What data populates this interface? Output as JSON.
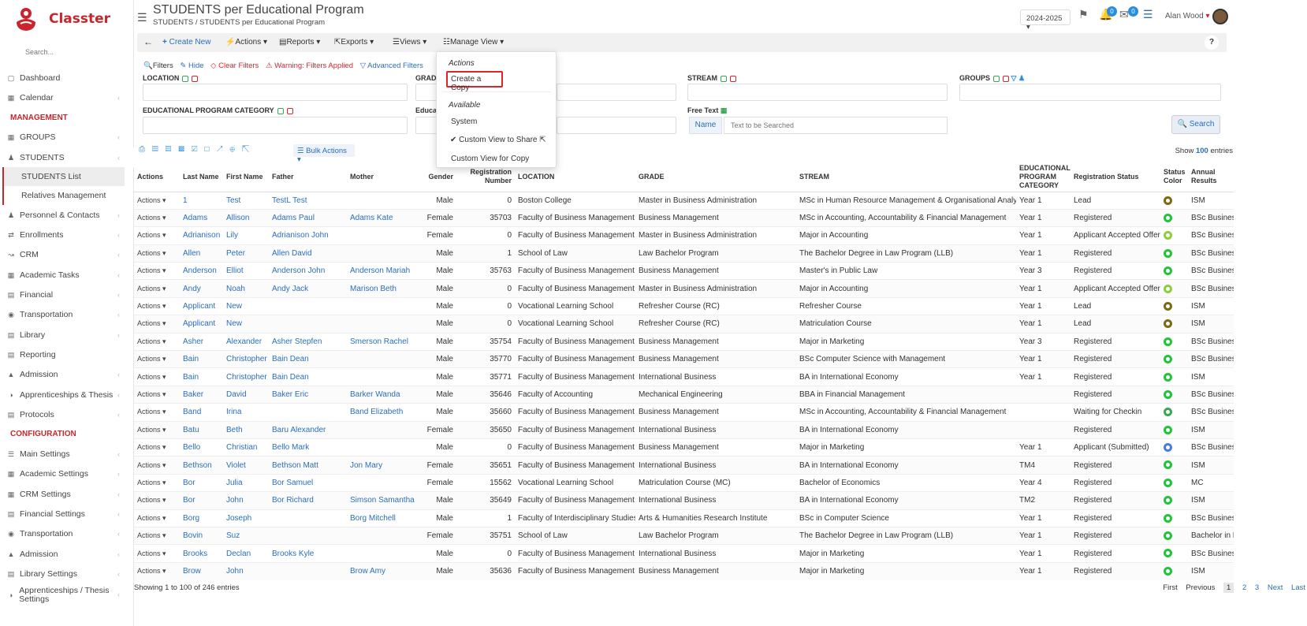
{
  "sidebar": {
    "brand": "Classter",
    "search_placeholder": "Search...",
    "items": [
      {
        "label": "Dashboard",
        "type": "item"
      },
      {
        "label": "Calendar",
        "type": "item",
        "chev": true
      },
      {
        "label": "MANAGEMENT",
        "type": "section"
      },
      {
        "label": "GROUPS",
        "type": "item",
        "chev": true
      },
      {
        "label": "STUDENTS",
        "type": "item",
        "chev": true,
        "active": true
      },
      {
        "label": "STUDENTS List",
        "type": "sub",
        "selected": true
      },
      {
        "label": "Relatives Management",
        "type": "sub"
      },
      {
        "label": "Personnel & Contacts",
        "type": "item",
        "chev": true
      },
      {
        "label": "Enrollments",
        "type": "item",
        "chev": true
      },
      {
        "label": "CRM",
        "type": "item",
        "chev": true
      },
      {
        "label": "Academic Tasks",
        "type": "item",
        "chev": true
      },
      {
        "label": "Financial",
        "type": "item",
        "chev": true
      },
      {
        "label": "Transportation",
        "type": "item",
        "chev": true
      },
      {
        "label": "Library",
        "type": "item",
        "chev": true
      },
      {
        "label": "Reporting",
        "type": "item"
      },
      {
        "label": "Admission",
        "type": "item",
        "chev": true
      },
      {
        "label": "Apprenticeships & Thesis",
        "type": "item",
        "chev": true
      },
      {
        "label": "Protocols",
        "type": "item",
        "chev": true
      },
      {
        "label": "CONFIGURATION",
        "type": "section"
      },
      {
        "label": "Main Settings",
        "type": "item",
        "chev": true
      },
      {
        "label": "Academic Settings",
        "type": "item",
        "chev": true
      },
      {
        "label": "CRM Settings",
        "type": "item",
        "chev": true
      },
      {
        "label": "Financial Settings",
        "type": "item",
        "chev": true
      },
      {
        "label": "Transportation",
        "type": "item",
        "chev": true
      },
      {
        "label": "Admission",
        "type": "item",
        "chev": true
      },
      {
        "label": "Library Settings",
        "type": "item",
        "chev": true
      },
      {
        "label": "Apprenticeships / Thesis Settings",
        "type": "item",
        "chev": true
      }
    ]
  },
  "header": {
    "title": "STUDENTS per Educational Program",
    "breadcrumb": "STUDENTS /  STUDENTS per Educational Program",
    "year": "2024-2025",
    "notif_count": "0",
    "msg_count": "0",
    "user": "Alan Wood"
  },
  "toolbar": {
    "create": "Create New",
    "actions": "Actions",
    "reports": "Reports",
    "exports": "Exports",
    "views": "Views",
    "manage": "Manage View",
    "help": "?"
  },
  "filters": {
    "filters": "Filters",
    "hide": "Hide",
    "clear": "Clear Filters",
    "warning": "Warning: Filters Applied",
    "advanced": "Advanced Filters",
    "location": "LOCATION",
    "grade": "GRADE",
    "stream": "STREAM",
    "groups": "GROUPS",
    "epc": "EDUCATIONAL PROGRAM CATEGORY",
    "educat": "Educat",
    "free_text": "Free Text",
    "name_tag": "Name",
    "free_placeholder": "Text to be Searched",
    "search": "Search"
  },
  "table_tools": {
    "bulk": "Bulk Actions",
    "show_prefix": "Show",
    "show_count": "100",
    "show_suffix": "entries"
  },
  "dropdown": {
    "actions_h": "Actions",
    "create_copy": "Create a Copy",
    "available_h": "Available",
    "system": "System",
    "custom_share": "Custom View to Share",
    "custom_copy": "Custom View for Copy"
  },
  "columns": [
    "Actions",
    "Last Name",
    "First Name",
    "Father",
    "Mother",
    "Gender",
    "Registration Number",
    "LOCATION",
    "GRADE",
    "STREAM",
    "EDUCATIONAL PROGRAM CATEGORY",
    "Registration Status",
    "Status Color",
    "Annual Results"
  ],
  "rows": [
    [
      "Actions",
      "1",
      "Test",
      "TestL Test",
      "",
      "Male",
      "0",
      "Boston College",
      "Master in Business Administration",
      "MSc in Human Resource Management & Organisational Analysis",
      "Year 1",
      "Lead",
      "#7a6a10",
      "ISM"
    ],
    [
      "Actions",
      "Adams",
      "Allison",
      "Adams Paul",
      "Adams Kate",
      "Female",
      "35703",
      "Faculty of Business Management",
      "Business Management",
      "MSc in Accounting, Accountability & Financial Management",
      "Year 1",
      "Registered",
      "#22c33a",
      "BSc Business I"
    ],
    [
      "Actions",
      "Adrianison",
      "Lily",
      "Adrianison John",
      "",
      "Female",
      "0",
      "Faculty of Business Management",
      "Master in Business Administration",
      "Major in Accounting",
      "Year 1",
      "Applicant Accepted Offer",
      "#8ccf3c",
      "BSc Business I"
    ],
    [
      "Actions",
      "Allen",
      "Peter",
      "Allen David",
      "",
      "Male",
      "1",
      "School of Law",
      "Law Bachelor Program",
      "The Bachelor Degree in Law Program (LLB)",
      "Year 1",
      "Registered",
      "#22c33a",
      "BSc Business I"
    ],
    [
      "Actions",
      "Anderson",
      "Elliot",
      "Anderson John",
      "Anderson Mariah",
      "Male",
      "35763",
      "Faculty of Business Management",
      "Business Management",
      "Master's in Public Law",
      "Year 3",
      "Registered",
      "#22c33a",
      "BSc Business I"
    ],
    [
      "Actions",
      "Andy",
      "Noah",
      "Andy Jack",
      "Marison Beth",
      "Male",
      "0",
      "Faculty of Business Management",
      "Master in Business Administration",
      "Major in Accounting",
      "Year 1",
      "Applicant Accepted Offer",
      "#8ccf3c",
      "BSc Business I"
    ],
    [
      "Actions",
      "Applicant",
      "New",
      "",
      "",
      "Male",
      "0",
      "Vocational Learning School",
      "Refresher Course (RC)",
      "Refresher Course",
      "Year 1",
      "Lead",
      "#7a6a10",
      "ISM"
    ],
    [
      "Actions",
      "Applicant",
      "New",
      "",
      "",
      "Male",
      "0",
      "Vocational Learning School",
      "Refresher Course (RC)",
      "Matriculation Course",
      "Year 1",
      "Lead",
      "#7a6a10",
      "ISM"
    ],
    [
      "Actions",
      "Asher",
      "Alexander",
      "Asher Stepfen",
      "Smerson Rachel",
      "Male",
      "35754",
      "Faculty of Business Management",
      "Business Management",
      "Major in Marketing",
      "Year 3",
      "Registered",
      "#22c33a",
      "BSc Business I"
    ],
    [
      "Actions",
      "Bain",
      "Christopher",
      "Bain Dean",
      "",
      "Male",
      "35770",
      "Faculty of Business Management",
      "Business Management",
      "BSc Computer Science with Management",
      "Year 1",
      "Registered",
      "#22c33a",
      "BSc Business I"
    ],
    [
      "Actions",
      "Bain",
      "Christopher",
      "Bain Dean",
      "",
      "Male",
      "35771",
      "Faculty of Business Management",
      "International Business",
      "BA in International Economy",
      "Year 1",
      "Registered",
      "#22c33a",
      "ISM"
    ],
    [
      "Actions",
      "Baker",
      "David",
      "Baker Eric",
      "Barker Wanda",
      "Male",
      "35646",
      "Faculty of Accounting",
      "Mechanical Engineering",
      "BBA in Financial Management",
      "",
      "Registered",
      "#22c33a",
      "BSc Business I"
    ],
    [
      "Actions",
      "Band",
      "Irina",
      "",
      "Band Elizabeth",
      "Male",
      "35660",
      "Faculty of Business Management",
      "Business Management",
      "MSc in Accounting, Accountability & Financial Management",
      "",
      "Waiting for Checkin",
      "#3aa655",
      "BSc Business I"
    ],
    [
      "Actions",
      "Batu",
      "Beth",
      "Baru Alexander",
      "",
      "Female",
      "35650",
      "Faculty of Business Management",
      "International Business",
      "BA in International Economy",
      "",
      "Registered",
      "#22c33a",
      "ISM"
    ],
    [
      "Actions",
      "Bello",
      "Christian",
      "Bello Mark",
      "",
      "Male",
      "0",
      "Faculty of Business Management",
      "Business Management",
      "Major in Marketing",
      "Year 1",
      "Applicant (Submitted)",
      "#4a7be0",
      "BSc Business I"
    ],
    [
      "Actions",
      "Bethson",
      "Violet",
      "Bethson Matt",
      "Jon Mary",
      "Female",
      "35651",
      "Faculty of Business Management",
      "International Business",
      "BA in International Economy",
      "TM4",
      "Registered",
      "#22c33a",
      "ISM"
    ],
    [
      "Actions",
      "Bor",
      "Julia",
      "Bor Samuel",
      "",
      "Female",
      "15562",
      "Vocational Learning School",
      "Matriculation Course (MC)",
      "Bachelor of Economics",
      "Year 4",
      "Registered",
      "#22c33a",
      "MC"
    ],
    [
      "Actions",
      "Bor",
      "John",
      "Bor Richard",
      "Simson Samantha",
      "Male",
      "35649",
      "Faculty of Business Management",
      "International Business",
      "BA in International Economy",
      "TM2",
      "Registered",
      "#22c33a",
      "ISM"
    ],
    [
      "Actions",
      "Borg",
      "Joseph",
      "",
      "Borg Mitchell",
      "Male",
      "1",
      "Faculty of Interdisciplinary Studies",
      "Arts & Humanities Research Institute",
      "BSc in Computer Science",
      "Year 1",
      "Registered",
      "#22c33a",
      "BSc Business I"
    ],
    [
      "Actions",
      "Bovin",
      "Suz",
      "",
      "",
      "Female",
      "35751",
      "School of Law",
      "Law Bachelor Program",
      "The Bachelor Degree in Law Program (LLB)",
      "Year 1",
      "Registered",
      "#22c33a",
      "Bachelor in La"
    ],
    [
      "Actions",
      "Brooks",
      "Declan",
      "Brooks Kyle",
      "",
      "Male",
      "0",
      "Faculty of Business Management",
      "International Business",
      "Major in Marketing",
      "Year 1",
      "Registered",
      "#22c33a",
      "BSc Business I"
    ],
    [
      "Actions",
      "Brow",
      "John",
      "",
      "Brow Amy",
      "Male",
      "35636",
      "Faculty of Business Management",
      "Business Management",
      "Major in Marketing",
      "Year 1",
      "Registered",
      "#22c33a",
      "ISM"
    ]
  ],
  "footer": {
    "showing": "Showing 1 to 100 of 246 entries",
    "first": "First",
    "previous": "Previous",
    "p1": "1",
    "p2": "2",
    "p3": "3",
    "next": "Next",
    "last": "Last"
  }
}
